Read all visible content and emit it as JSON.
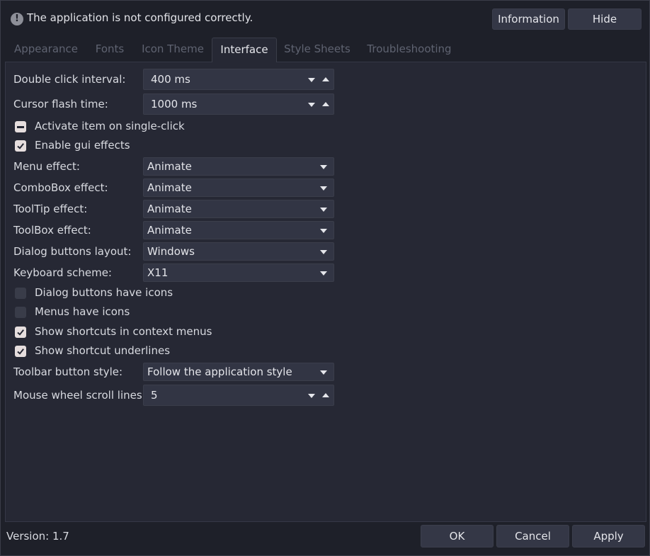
{
  "message": {
    "text": "The application is not configured correctly.",
    "icon": "warning-icon"
  },
  "header_buttons": {
    "information": "Information",
    "hide": "Hide"
  },
  "tabs": [
    {
      "label": "Appearance",
      "active": false
    },
    {
      "label": "Fonts",
      "active": false
    },
    {
      "label": "Icon Theme",
      "active": false
    },
    {
      "label": "Interface",
      "active": true
    },
    {
      "label": "Style Sheets",
      "active": false
    },
    {
      "label": "Troubleshooting",
      "active": false
    }
  ],
  "interface": {
    "double_click_label": "Double click interval:",
    "double_click_value": "400 ms",
    "cursor_flash_label": "Cursor flash time:",
    "cursor_flash_value": "1000 ms",
    "activate_single_click": "Activate item on single-click",
    "enable_gui_effects": "Enable gui effects",
    "menu_effect_label": "Menu effect:",
    "menu_effect_value": "Animate",
    "combobox_effect_label": "ComboBox effect:",
    "combobox_effect_value": "Animate",
    "tooltip_effect_label": "ToolTip effect:",
    "tooltip_effect_value": "Animate",
    "toolbox_effect_label": "ToolBox effect:",
    "toolbox_effect_value": "Animate",
    "dialog_layout_label": "Dialog buttons layout:",
    "dialog_layout_value": "Windows",
    "keyboard_scheme_label": "Keyboard scheme:",
    "keyboard_scheme_value": "X11",
    "dialog_buttons_icons": "Dialog buttons have icons",
    "menus_icons": "Menus have icons",
    "show_shortcuts_context": "Show shortcuts in context menus",
    "show_shortcut_underlines": "Show shortcut underlines",
    "toolbar_style_label": "Toolbar button style:",
    "toolbar_style_value": "Follow the application style",
    "wheel_lines_label": "Mouse wheel scroll lines:",
    "wheel_lines_value": "5"
  },
  "checkbox_states": {
    "activate_single_click": "partial",
    "enable_gui_effects": "checked",
    "dialog_buttons_icons": "unchecked",
    "menus_icons": "unchecked",
    "show_shortcuts_context": "checked",
    "show_shortcut_underlines": "checked"
  },
  "footer": {
    "version": "Version: 1.7",
    "ok": "OK",
    "cancel": "Cancel",
    "apply": "Apply"
  },
  "colors": {
    "background": "#1e2029",
    "panel": "#262834",
    "control": "#323544",
    "checkbox_checked": "#e6dede",
    "text": "#d8dae0"
  }
}
